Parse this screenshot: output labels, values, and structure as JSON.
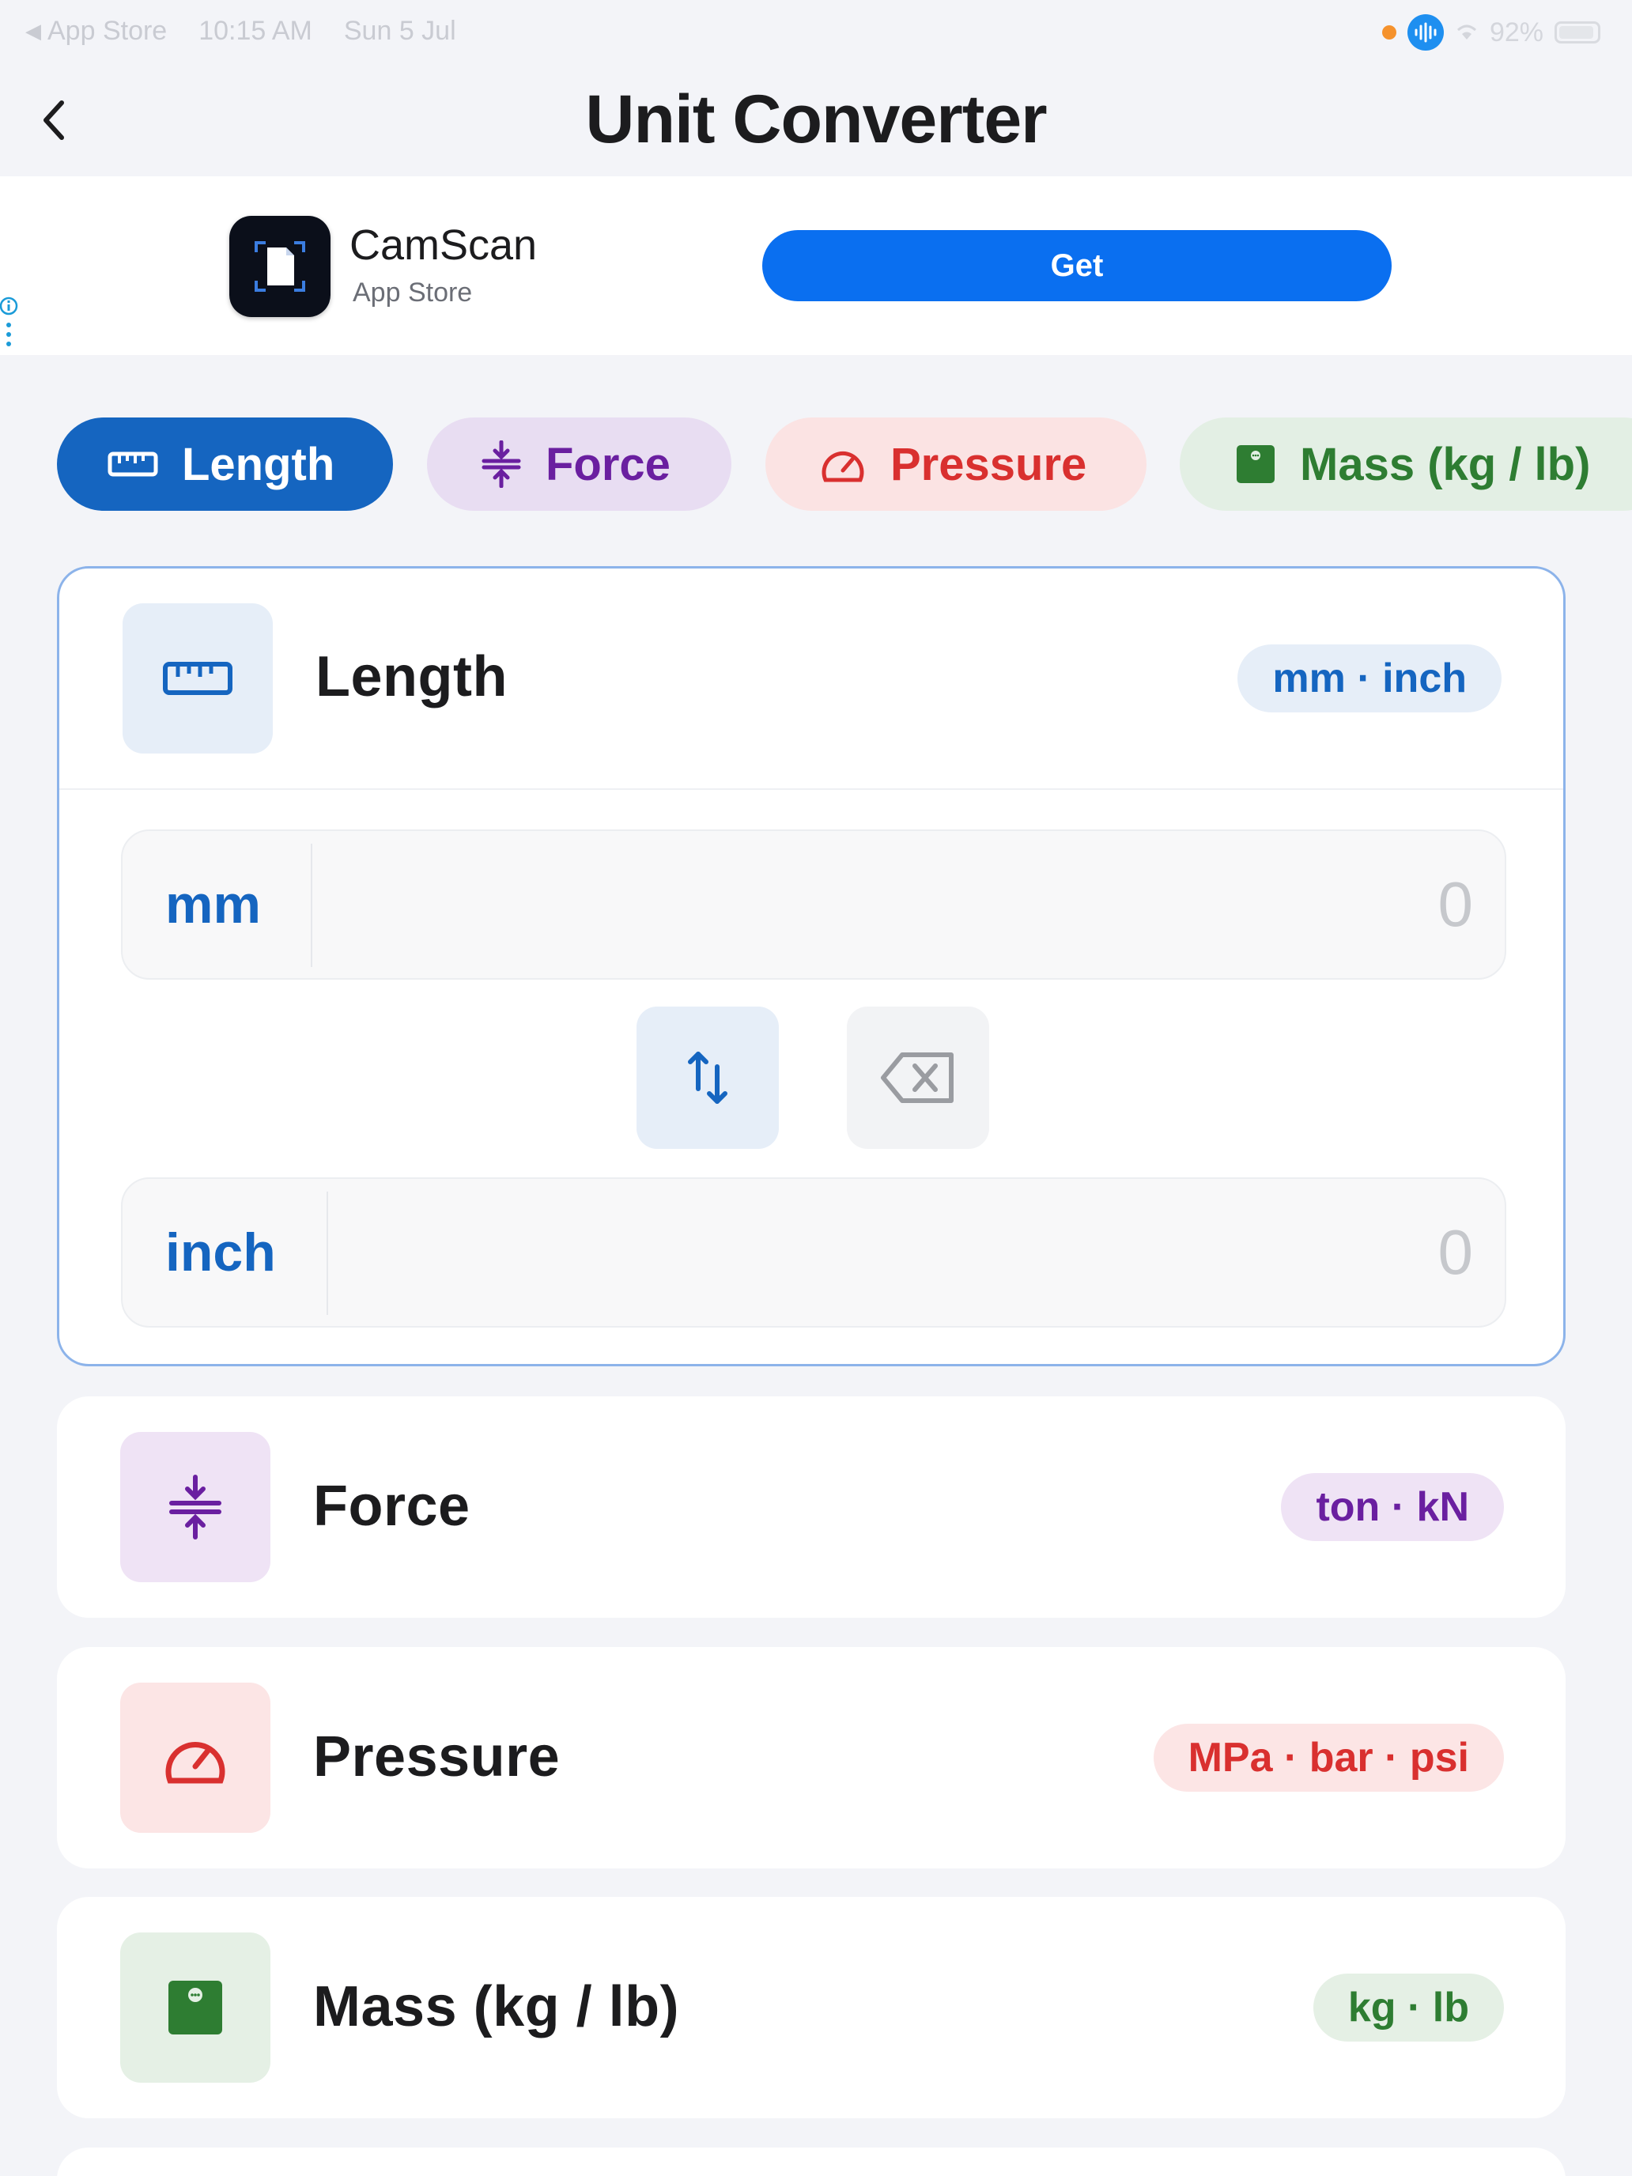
{
  "status_bar": {
    "back_app": "App Store",
    "time": "10:15 AM",
    "date": "Sun 5 Jul",
    "battery": "92%"
  },
  "nav": {
    "title": "Unit Converter"
  },
  "ad": {
    "app_name": "CamScan",
    "source": "App Store",
    "cta": "Get"
  },
  "chips": [
    {
      "label": "Length",
      "icon": "ruler-icon",
      "selected": true
    },
    {
      "label": "Force",
      "icon": "compress-icon",
      "selected": false
    },
    {
      "label": "Pressure",
      "icon": "gauge-icon",
      "selected": false
    },
    {
      "label": "Mass (kg / lb)",
      "icon": "scale-icon",
      "selected": false
    }
  ],
  "cards": {
    "length": {
      "title": "Length",
      "units": "mm · inch",
      "from_unit": "mm",
      "from_value": "0",
      "to_unit": "inch",
      "to_value": "0"
    },
    "force": {
      "title": "Force",
      "units": "ton · kN"
    },
    "pressure": {
      "title": "Pressure",
      "units": "MPa · bar · psi"
    },
    "mass": {
      "title": "Mass (kg / lb)",
      "units": "kg · lb"
    }
  },
  "colors": {
    "length": "#1565c0",
    "force": "#6a1fa0",
    "pressure": "#d9302f",
    "mass": "#2e7d32",
    "get_button": "#0a6ff0"
  }
}
